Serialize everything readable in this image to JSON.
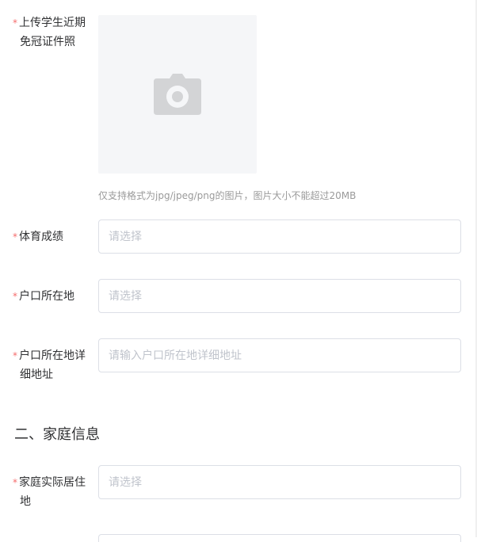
{
  "photo_upload": {
    "required_mark": "*",
    "label_line1": "上传学生近期",
    "label_line2": "免冠证件照",
    "icon": "camera-icon",
    "hint": "仅支持格式为jpg/jpeg/png的图片，图片大小不能超过20MB"
  },
  "pe_score": {
    "required_mark": "*",
    "label": "体育成绩",
    "placeholder": "请选择"
  },
  "hukou_location": {
    "required_mark": "*",
    "label": "户口所在地",
    "placeholder": "请选择"
  },
  "hukou_address": {
    "required_mark": "*",
    "label_line1": "户口所在地详",
    "label_line2": "细地址",
    "placeholder": "请输入户口所在地详细地址"
  },
  "section_family": {
    "title": "二、家庭信息"
  },
  "family_residence": {
    "required_mark": "*",
    "label_line1": "家庭实际居住",
    "label_line2": "地",
    "placeholder": "请选择"
  },
  "colors": {
    "required": "#f56c6c",
    "placeholder": "#c0c4cc",
    "border": "#dcdfe6",
    "upload_bg": "#f5f6f8",
    "icon": "#d3d4d6"
  }
}
